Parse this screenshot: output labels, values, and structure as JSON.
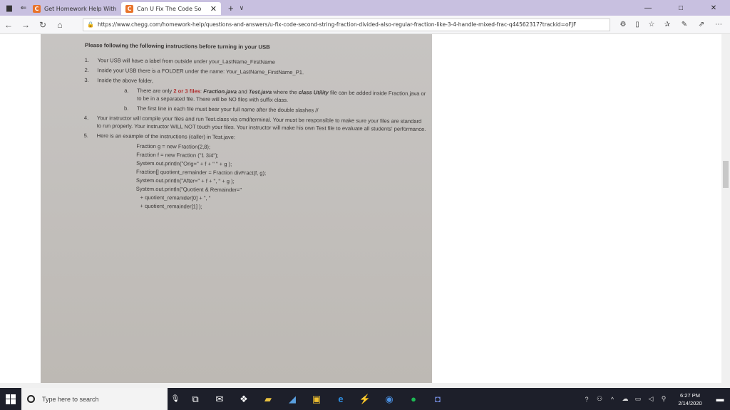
{
  "browser": {
    "tabs": [
      {
        "title": "Get Homework Help With C",
        "favicon": "C",
        "active": false
      },
      {
        "title": "Can U Fix The Code So",
        "favicon": "C",
        "active": true
      }
    ],
    "new_tab_symbol": "+",
    "tab_dropdown_symbol": "∨",
    "url": "https://www.chegg.com/homework-help/questions-and-answers/u-fix-code-second-string-fraction-divided-also-regular-fraction-like-3-4-handle-mixed-frac-q44562317?trackid=oFJF",
    "window_controls": {
      "minimize": "—",
      "maximize": "□",
      "close": "✕"
    }
  },
  "document": {
    "heading": "Please following the following instructions before turning in your USB",
    "items": [
      {
        "num": "1.",
        "text": "Your USB will have a label from outside under your_LastName_FirstName"
      },
      {
        "num": "2.",
        "text": "Inside your USB there is a FOLDER under the name: Your_LastName_FirstName_P1."
      },
      {
        "num": "3.",
        "text": "Inside the above folder,"
      }
    ],
    "sub_a": {
      "num": "a.",
      "pre": "There are only ",
      "count": "2 or 3 files",
      "mid": ": ",
      "file1": "Fraction.java",
      "and": " and ",
      "file2": "Test.java",
      "mid2": " where the ",
      "file3": "class Utility",
      "post": " file can be added inside Fraction.java or to be in a separated file. There will be NO files with suffix class."
    },
    "sub_b": {
      "num": "b.",
      "text": "The first line in each file must bear your full name after the double slashes //"
    },
    "item4": {
      "num": "4.",
      "text": "Your instructor will compile your files and run Test.class via cmd/terminal. Your must be responsible to make sure your files are standard to run properly. Your instructor WILL NOT touch your files. Your instructor will make his own Test file to evaluate all students' performance."
    },
    "item5": {
      "num": "5.",
      "text": "Here is an example of the instructions (caller) in Test.jave:"
    },
    "code": [
      "Fraction g = new Fraction(2,8);",
      "Fraction f = new Fraction (\"1 3/4\");",
      "System.out.println(\"Orig=\" + f + \" \" + g );",
      "Fraction[] quotient_remainder = Fraction divFract(f, g);",
      "System.out.println(\"After=\" + f + \", \" + g );",
      "System.out.println(\"Quotient & Remainder=\"",
      "+ quotient_remanider[0] + \", \"",
      "+ quotient_remainder[1]      );"
    ]
  },
  "taskbar": {
    "search_placeholder": "Type here to search",
    "time": "6:27 PM",
    "date": "2/14/2020"
  }
}
